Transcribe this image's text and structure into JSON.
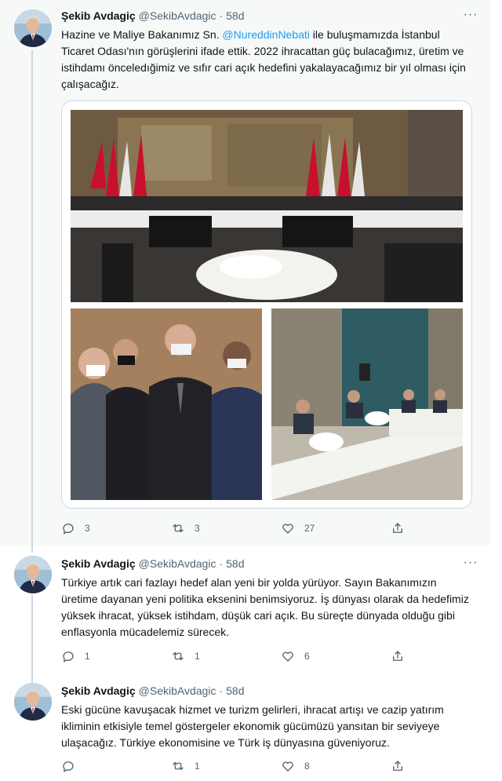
{
  "author": {
    "name": "Şekib Avdagiç",
    "handle": "@SekibAvdagic",
    "separator": "·",
    "more": "···"
  },
  "tweets": [
    {
      "time": "58d",
      "text_before": "Hazine ve Maliye Bakanımız Sn. ",
      "mention": "@NureddinNebati",
      "text_after": " ile buluşmamızda İstanbul Ticaret Odası'nın görüşlerini ifade ettik. 2022 ihracattan güç bulacağımız, üretim ve istihdamı önceledığimiz ve sıfır cari açık hedefini yakalayacağımız bir yıl olması için çalışacağız.",
      "photos": [
        "meeting-hall-photo",
        "masked-officials-photo",
        "meeting-room-photo"
      ],
      "replies": "3",
      "retweets": "3",
      "likes": "27"
    },
    {
      "time": "58d",
      "text": "Türkiye artık cari fazlayı hedef alan yeni bir yolda yürüyor. Sayın Bakanımızın üretime dayanan yeni politika eksenini benimsiyoruz. İş dünyası olarak da hedefimiz yüksek ihracat, yüksek istihdam, düşük cari açık. Bu süreçte dünyada olduğu gibi enflasyonla mücadelemiz sürecek.",
      "replies": "1",
      "retweets": "1",
      "likes": "6"
    },
    {
      "time": "58d",
      "text": "Eski gücüne kavuşacak hizmet ve turizm gelirleri, ihracat artışı ve cazip yatırım ikliminin etkisiyle temel göstergeler ekonomik gücümüzü yansıtan bir seviyeye ulaşacağız. Türkiye ekonomisine ve Türk iş dünyasına güveniyoruz.",
      "replies": "",
      "retweets": "1",
      "likes": "8"
    }
  ],
  "icons": {
    "reply": "reply-icon",
    "retweet": "retweet-icon",
    "like": "heart-icon",
    "share": "share-icon",
    "more": "more-icon"
  },
  "colors": {
    "link": "#1d9bf0",
    "secondary_text": "#536471",
    "thread_line": "#cfd9de",
    "highlight_bg": "#f7f9f9"
  }
}
